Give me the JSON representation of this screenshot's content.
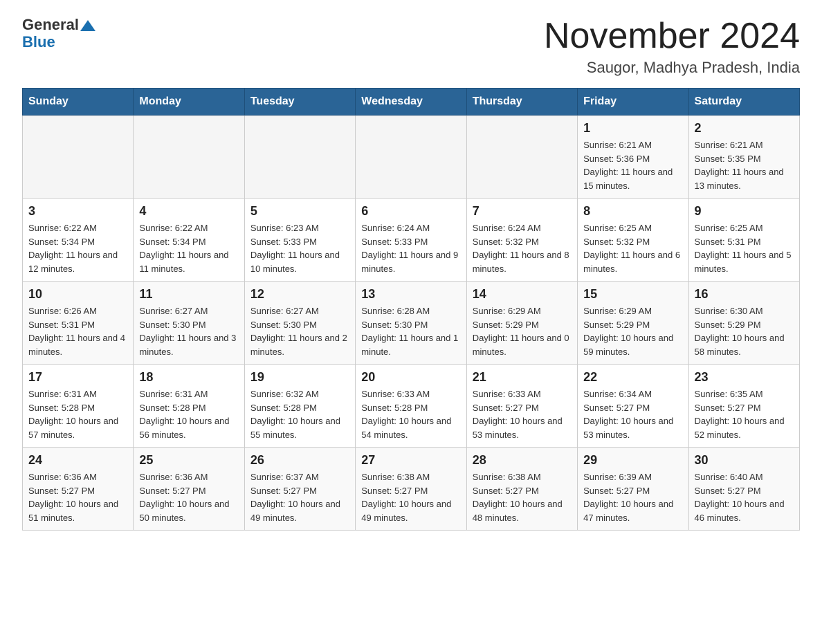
{
  "logo": {
    "general": "General",
    "arrow": "▲",
    "blue": "Blue"
  },
  "title": "November 2024",
  "subtitle": "Saugor, Madhya Pradesh, India",
  "days_of_week": [
    "Sunday",
    "Monday",
    "Tuesday",
    "Wednesday",
    "Thursday",
    "Friday",
    "Saturday"
  ],
  "weeks": [
    [
      {
        "day": "",
        "info": ""
      },
      {
        "day": "",
        "info": ""
      },
      {
        "day": "",
        "info": ""
      },
      {
        "day": "",
        "info": ""
      },
      {
        "day": "",
        "info": ""
      },
      {
        "day": "1",
        "info": "Sunrise: 6:21 AM\nSunset: 5:36 PM\nDaylight: 11 hours and 15 minutes."
      },
      {
        "day": "2",
        "info": "Sunrise: 6:21 AM\nSunset: 5:35 PM\nDaylight: 11 hours and 13 minutes."
      }
    ],
    [
      {
        "day": "3",
        "info": "Sunrise: 6:22 AM\nSunset: 5:34 PM\nDaylight: 11 hours and 12 minutes."
      },
      {
        "day": "4",
        "info": "Sunrise: 6:22 AM\nSunset: 5:34 PM\nDaylight: 11 hours and 11 minutes."
      },
      {
        "day": "5",
        "info": "Sunrise: 6:23 AM\nSunset: 5:33 PM\nDaylight: 11 hours and 10 minutes."
      },
      {
        "day": "6",
        "info": "Sunrise: 6:24 AM\nSunset: 5:33 PM\nDaylight: 11 hours and 9 minutes."
      },
      {
        "day": "7",
        "info": "Sunrise: 6:24 AM\nSunset: 5:32 PM\nDaylight: 11 hours and 8 minutes."
      },
      {
        "day": "8",
        "info": "Sunrise: 6:25 AM\nSunset: 5:32 PM\nDaylight: 11 hours and 6 minutes."
      },
      {
        "day": "9",
        "info": "Sunrise: 6:25 AM\nSunset: 5:31 PM\nDaylight: 11 hours and 5 minutes."
      }
    ],
    [
      {
        "day": "10",
        "info": "Sunrise: 6:26 AM\nSunset: 5:31 PM\nDaylight: 11 hours and 4 minutes."
      },
      {
        "day": "11",
        "info": "Sunrise: 6:27 AM\nSunset: 5:30 PM\nDaylight: 11 hours and 3 minutes."
      },
      {
        "day": "12",
        "info": "Sunrise: 6:27 AM\nSunset: 5:30 PM\nDaylight: 11 hours and 2 minutes."
      },
      {
        "day": "13",
        "info": "Sunrise: 6:28 AM\nSunset: 5:30 PM\nDaylight: 11 hours and 1 minute."
      },
      {
        "day": "14",
        "info": "Sunrise: 6:29 AM\nSunset: 5:29 PM\nDaylight: 11 hours and 0 minutes."
      },
      {
        "day": "15",
        "info": "Sunrise: 6:29 AM\nSunset: 5:29 PM\nDaylight: 10 hours and 59 minutes."
      },
      {
        "day": "16",
        "info": "Sunrise: 6:30 AM\nSunset: 5:29 PM\nDaylight: 10 hours and 58 minutes."
      }
    ],
    [
      {
        "day": "17",
        "info": "Sunrise: 6:31 AM\nSunset: 5:28 PM\nDaylight: 10 hours and 57 minutes."
      },
      {
        "day": "18",
        "info": "Sunrise: 6:31 AM\nSunset: 5:28 PM\nDaylight: 10 hours and 56 minutes."
      },
      {
        "day": "19",
        "info": "Sunrise: 6:32 AM\nSunset: 5:28 PM\nDaylight: 10 hours and 55 minutes."
      },
      {
        "day": "20",
        "info": "Sunrise: 6:33 AM\nSunset: 5:28 PM\nDaylight: 10 hours and 54 minutes."
      },
      {
        "day": "21",
        "info": "Sunrise: 6:33 AM\nSunset: 5:27 PM\nDaylight: 10 hours and 53 minutes."
      },
      {
        "day": "22",
        "info": "Sunrise: 6:34 AM\nSunset: 5:27 PM\nDaylight: 10 hours and 53 minutes."
      },
      {
        "day": "23",
        "info": "Sunrise: 6:35 AM\nSunset: 5:27 PM\nDaylight: 10 hours and 52 minutes."
      }
    ],
    [
      {
        "day": "24",
        "info": "Sunrise: 6:36 AM\nSunset: 5:27 PM\nDaylight: 10 hours and 51 minutes."
      },
      {
        "day": "25",
        "info": "Sunrise: 6:36 AM\nSunset: 5:27 PM\nDaylight: 10 hours and 50 minutes."
      },
      {
        "day": "26",
        "info": "Sunrise: 6:37 AM\nSunset: 5:27 PM\nDaylight: 10 hours and 49 minutes."
      },
      {
        "day": "27",
        "info": "Sunrise: 6:38 AM\nSunset: 5:27 PM\nDaylight: 10 hours and 49 minutes."
      },
      {
        "day": "28",
        "info": "Sunrise: 6:38 AM\nSunset: 5:27 PM\nDaylight: 10 hours and 48 minutes."
      },
      {
        "day": "29",
        "info": "Sunrise: 6:39 AM\nSunset: 5:27 PM\nDaylight: 10 hours and 47 minutes."
      },
      {
        "day": "30",
        "info": "Sunrise: 6:40 AM\nSunset: 5:27 PM\nDaylight: 10 hours and 46 minutes."
      }
    ]
  ]
}
